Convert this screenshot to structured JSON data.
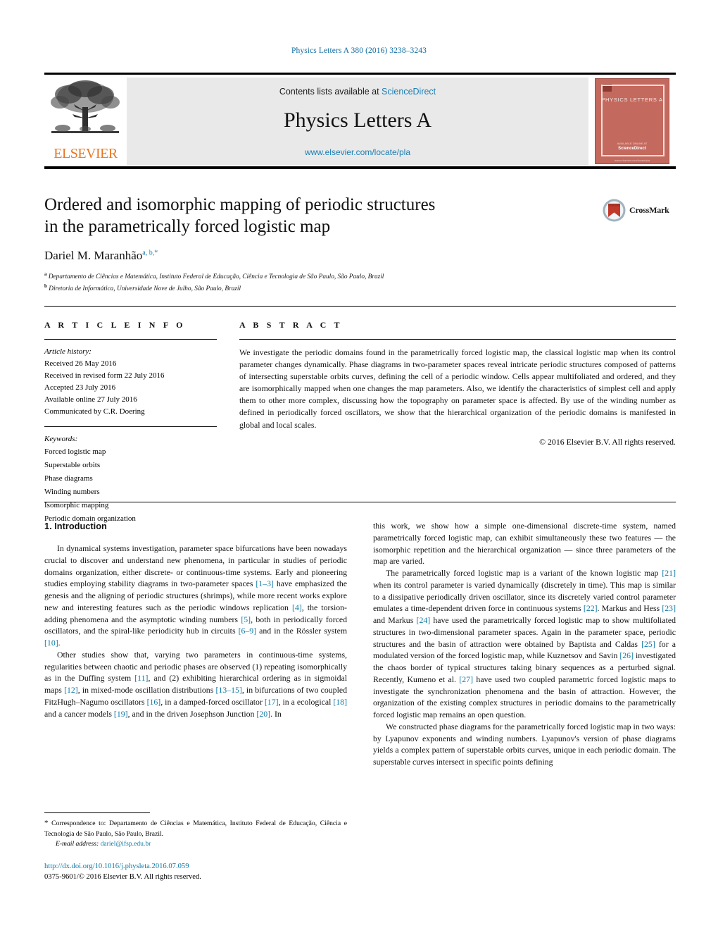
{
  "running_head": "Physics Letters A 380 (2016) 3238–3243",
  "masthead": {
    "contents_prefix": "Contents lists available at ",
    "sciencedirect": "ScienceDirect",
    "journal_title": "Physics Letters A",
    "journal_url": "www.elsevier.com/locate/pla",
    "publisher_wordmark": "ELSEVIER",
    "cover": {
      "title": "PHYSICS LETTERS A",
      "foot_small": "AVAILABLE ONLINE AT",
      "foot_brand": "ScienceDirect",
      "foot_tiny": "www.elsevier.com/locate/pla"
    }
  },
  "article": {
    "title_line1": "Ordered and isomorphic mapping of periodic structures",
    "title_line2": "in the parametrically forced logistic map",
    "author": "Dariel M. Maranhão",
    "author_marks": "a, b,*",
    "affiliations": [
      {
        "mark": "a",
        "text": "Departamento de Ciências e Matemática, Instituto Federal de Educação, Ciência e Tecnologia de São Paulo, São Paulo, Brazil"
      },
      {
        "mark": "b",
        "text": "Diretoria de Informática, Universidade Nove de Julho, São Paulo, Brazil"
      }
    ],
    "crossmark_label": "CrossMark"
  },
  "info": {
    "heading": "A R T I C L E   I N F O",
    "history_label": "Article history:",
    "history": [
      "Received 26 May 2016",
      "Received in revised form 22 July 2016",
      "Accepted 23 July 2016",
      "Available online 27 July 2016",
      "Communicated by C.R. Doering"
    ],
    "keywords_label": "Keywords:",
    "keywords": [
      "Forced logistic map",
      "Superstable orbits",
      "Phase diagrams",
      "Winding numbers",
      "Isomorphic mapping",
      "Periodic domain organization"
    ]
  },
  "abstract": {
    "heading": "A B S T R A C T",
    "text": "We investigate the periodic domains found in the parametrically forced logistic map, the classical logistic map when its control parameter changes dynamically. Phase diagrams in two-parameter spaces reveal intricate periodic structures composed of patterns of intersecting superstable orbits curves, defining the cell of a periodic window. Cells appear multifoliated and ordered, and they are isomorphically mapped when one changes the map parameters. Also, we identify the characteristics of simplest cell and apply them to other more complex, discussing how the topography on parameter space is affected. By use of the winding number as defined in periodically forced oscillators, we show that the hierarchical organization of the periodic domains is manifested in global and local scales.",
    "copyright": "© 2016 Elsevier B.V. All rights reserved."
  },
  "body": {
    "section_number_title": "1. Introduction",
    "left_paragraphs": [
      "In dynamical systems investigation, parameter space bifurcations have been nowadays crucial to discover and understand new phenomena, in particular in studies of periodic domains organization, either discrete- or continuous-time systems. Early and pioneering studies employing stability diagrams in two-parameter spaces [1–3] have emphasized the genesis and the aligning of periodic structures (shrimps), while more recent works explore new and interesting features such as the periodic windows replication [4], the torsion-adding phenomena and the asymptotic winding numbers [5], both in periodically forced oscillators, and the spiral-like periodicity hub in circuits [6–9] and in the Rössler system [10].",
      "Other studies show that, varying two parameters in continuous-time systems, regularities between chaotic and periodic phases are observed (1) repeating isomorphically as in the Duffing system [11], and (2) exhibiting hierarchical ordering as in sigmoidal maps [12], in mixed-mode oscillation distributions [13–15], in bifurcations of two coupled FitzHugh–Nagumo oscillators [16], in a damped-forced oscillator [17], in a ecological [18] and a cancer models [19], and in the driven Josephson Junction [20]. In"
    ],
    "right_paragraphs": [
      "this work, we show how a simple one-dimensional discrete-time system, named parametrically forced logistic map, can exhibit simultaneously these two features — the isomorphic repetition and the hierarchical organization — since three parameters of the map are varied.",
      "The parametrically forced logistic map is a variant of the known logistic map [21] when its control parameter is varied dynamically (discretely in time). This map is similar to a dissipative periodically driven oscillator, since its discretely varied control parameter emulates a time-dependent driven force in continuous systems [22]. Markus and Hess [23] and Markus [24] have used the parametrically forced logistic map to show multifoliated structures in two-dimensional parameter spaces. Again in the parameter space, periodic structures and the basin of attraction were obtained by Baptista and Caldas [25] for a modulated version of the forced logistic map, while Kuznetsov and Savin [26] investigated the chaos border of typical structures taking binary sequences as a perturbed signal. Recently, Kumeno et al. [27] have used two coupled parametric forced logistic maps to investigate the synchronization phenomena and the basin of attraction. However, the organization of the existing complex structures in periodic domains to the parametrically forced logistic map remains an open question.",
      "We constructed phase diagrams for the parametrically forced logistic map in two ways: by Lyapunov exponents and winding numbers. Lyapunov's version of phase diagrams yields a complex pattern of superstable orbits curves, unique in each periodic domain. The superstable curves intersect in specific points defining"
    ]
  },
  "footnote": {
    "correspondence": "Correspondence to: Departamento de Ciências e Matemática, Instituto Federal de Educação, Ciência e Tecnologia de São Paulo, São Paulo, Brazil.",
    "email_label": "E-mail address:",
    "email": "dariel@ifsp.edu.br",
    "doi": "http://dx.doi.org/10.1016/j.physleta.2016.07.059",
    "issn_line": "0375-9601/© 2016 Elsevier B.V. All rights reserved."
  },
  "colors": {
    "link": "#0f7aa8",
    "elsevier_orange": "#e87722",
    "masthead_gray": "#e9e9e9",
    "cover_red": "#c4695e"
  }
}
